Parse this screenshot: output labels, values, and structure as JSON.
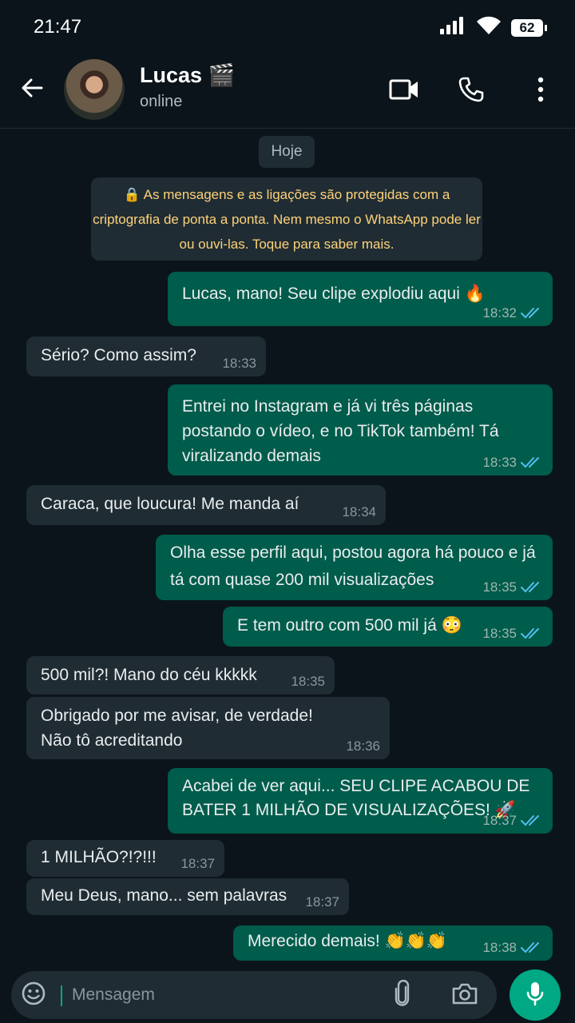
{
  "status_bar": {
    "time": "21:47",
    "battery": "62"
  },
  "header": {
    "name": "Lucas 🎬",
    "status": "online"
  },
  "chat": {
    "day": "Hoje",
    "encryption_notice": "🔒 As mensagens e as ligações são protegidas com a criptografia de ponta a ponta. Nem mesmo o WhatsApp pode ler ou ouvi-las. Toque para saber mais.",
    "messages": [
      {
        "dir": "out",
        "text": "Lucas, mano! Seu clipe explodiu aqui 🔥",
        "time": "18:32"
      },
      {
        "dir": "in",
        "text": "Sério? Como assim?",
        "time": "18:33"
      },
      {
        "dir": "out",
        "text": "Entrei no Instagram e já vi três páginas postando o vídeo, e no TikTok também! Tá viralizando demais",
        "time": "18:33"
      },
      {
        "dir": "in",
        "text": "Caraca, que loucura! Me manda aí",
        "time": "18:34"
      },
      {
        "dir": "out",
        "text": "Olha esse perfil aqui, postou agora há pouco e já tá com quase 200 mil visualizações",
        "time": "18:35"
      },
      {
        "dir": "out",
        "text": "E tem outro com 500 mil já 😳",
        "time": "18:35"
      },
      {
        "dir": "in",
        "text": "500 mil?! Mano do céu kkkkk",
        "time": "18:35"
      },
      {
        "dir": "in",
        "text": "Obrigado por me avisar, de verdade! Não tô acreditando",
        "time": "18:36"
      },
      {
        "dir": "out",
        "text": "Acabei de ver aqui... SEU CLIPE ACABOU DE BATER 1 MILHÃO DE VISUALIZAÇÕES! 🚀",
        "time": "18:37"
      },
      {
        "dir": "in",
        "text": "1 MILHÃO?!?!!!",
        "time": "18:37"
      },
      {
        "dir": "in",
        "text": "Meu Deus, mano... sem palavras",
        "time": "18:37"
      },
      {
        "dir": "out",
        "text": "Merecido demais! 👏👏👏",
        "time": "18:38"
      }
    ]
  },
  "composer": {
    "placeholder": "Mensagem"
  },
  "icons": {
    "back": "arrow-left-icon",
    "video_call": "video-camera-icon",
    "voice_call": "phone-icon",
    "menu": "more-vertical-icon",
    "emoji": "emoji-icon",
    "attach": "paperclip-icon",
    "camera": "camera-icon",
    "mic": "microphone-icon",
    "read_receipt": "double-check-icon"
  },
  "colors": {
    "outgoing_bubble": "#005c4b",
    "incoming_bubble": "#1f2c33",
    "read_tick": "#53bdeb",
    "accent": "#00a884",
    "notice_text": "#ffd279"
  }
}
